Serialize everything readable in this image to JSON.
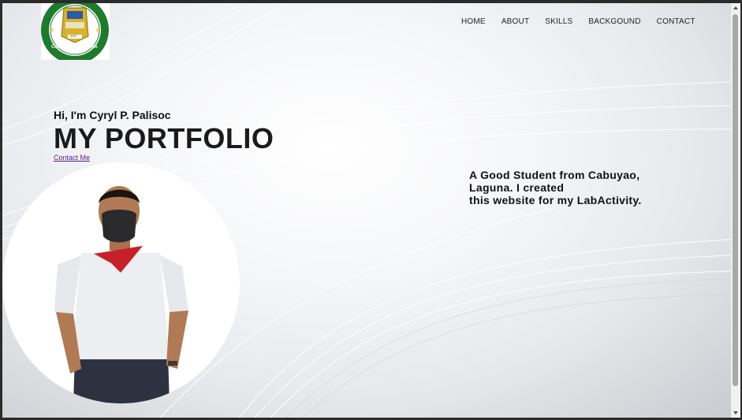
{
  "logo": {
    "top_text": "BANAY-BANAY NATIONAL HIGH SCHOOL",
    "bottom_text": "CABUYAO, LAGUNA",
    "year": "2007"
  },
  "nav": {
    "items": [
      {
        "label": "HOME"
      },
      {
        "label": "ABOUT"
      },
      {
        "label": "SKILLS"
      },
      {
        "label": "BACKGOUND"
      },
      {
        "label": "CONTACT"
      }
    ]
  },
  "hero": {
    "greeting": "Hi, I'm Cyryl P. Palisoc",
    "title": "MY PORTFOLIO",
    "contact_link": "Contact Me"
  },
  "tagline": {
    "line1": "A Good Student from Cabuyao,",
    "line2": "Laguna. I created",
    "line3": "this website for my LabActivity."
  },
  "colors": {
    "logo_green": "#1f7a2e",
    "logo_gold": "#d8b22a",
    "logo_blue": "#2b5aa8",
    "neckerchief_red": "#c8202a"
  }
}
